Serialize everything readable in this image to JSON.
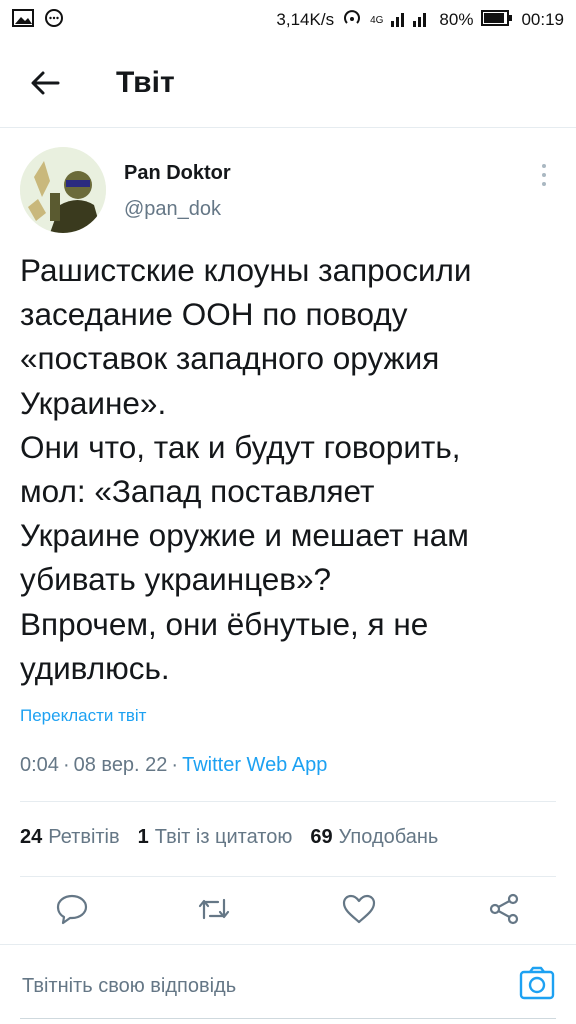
{
  "status_bar": {
    "speed": "3,14K/s",
    "network": "4G",
    "battery": "80%",
    "time": "00:19",
    "icons": [
      "image-icon",
      "chat-bubble-icon",
      "hotspot-icon",
      "signal-icon",
      "battery-icon"
    ]
  },
  "header": {
    "title": "Твіт",
    "back_icon": "arrow-left-icon"
  },
  "tweet": {
    "author_name": "Pan Doktor",
    "author_handle": "@pan_dok",
    "text": "Рашистские клоуны запросили\nзаседание ООН по поводу\n«поставок западного оружия\nУкраине».\nОни что, так и будут говорить,\nмол: «Запад поставляет\nУкраине оружие и мешает нам\nубивать украинцев»?\nВпрочем, они ёбнутые, я не\nудивлюсь.",
    "translate_label": "Перекласти твіт",
    "time": "0:04",
    "date": "08 вер. 22",
    "source": "Twitter Web App"
  },
  "stats": {
    "retweets_count": "24",
    "retweets_label": "Ретвітів",
    "quotes_count": "1",
    "quotes_label": "Твіт із цитатою",
    "likes_count": "69",
    "likes_label": "Уподобань"
  },
  "actions": [
    "reply-icon",
    "retweet-icon",
    "like-icon",
    "share-icon"
  ],
  "reply": {
    "placeholder": "Твітніть свою відповідь",
    "camera_icon": "camera-icon"
  },
  "colors": {
    "accent": "#1da1f2",
    "secondary_text": "#657786",
    "primary_text": "#14171a",
    "divider": "#e6ecf0"
  }
}
